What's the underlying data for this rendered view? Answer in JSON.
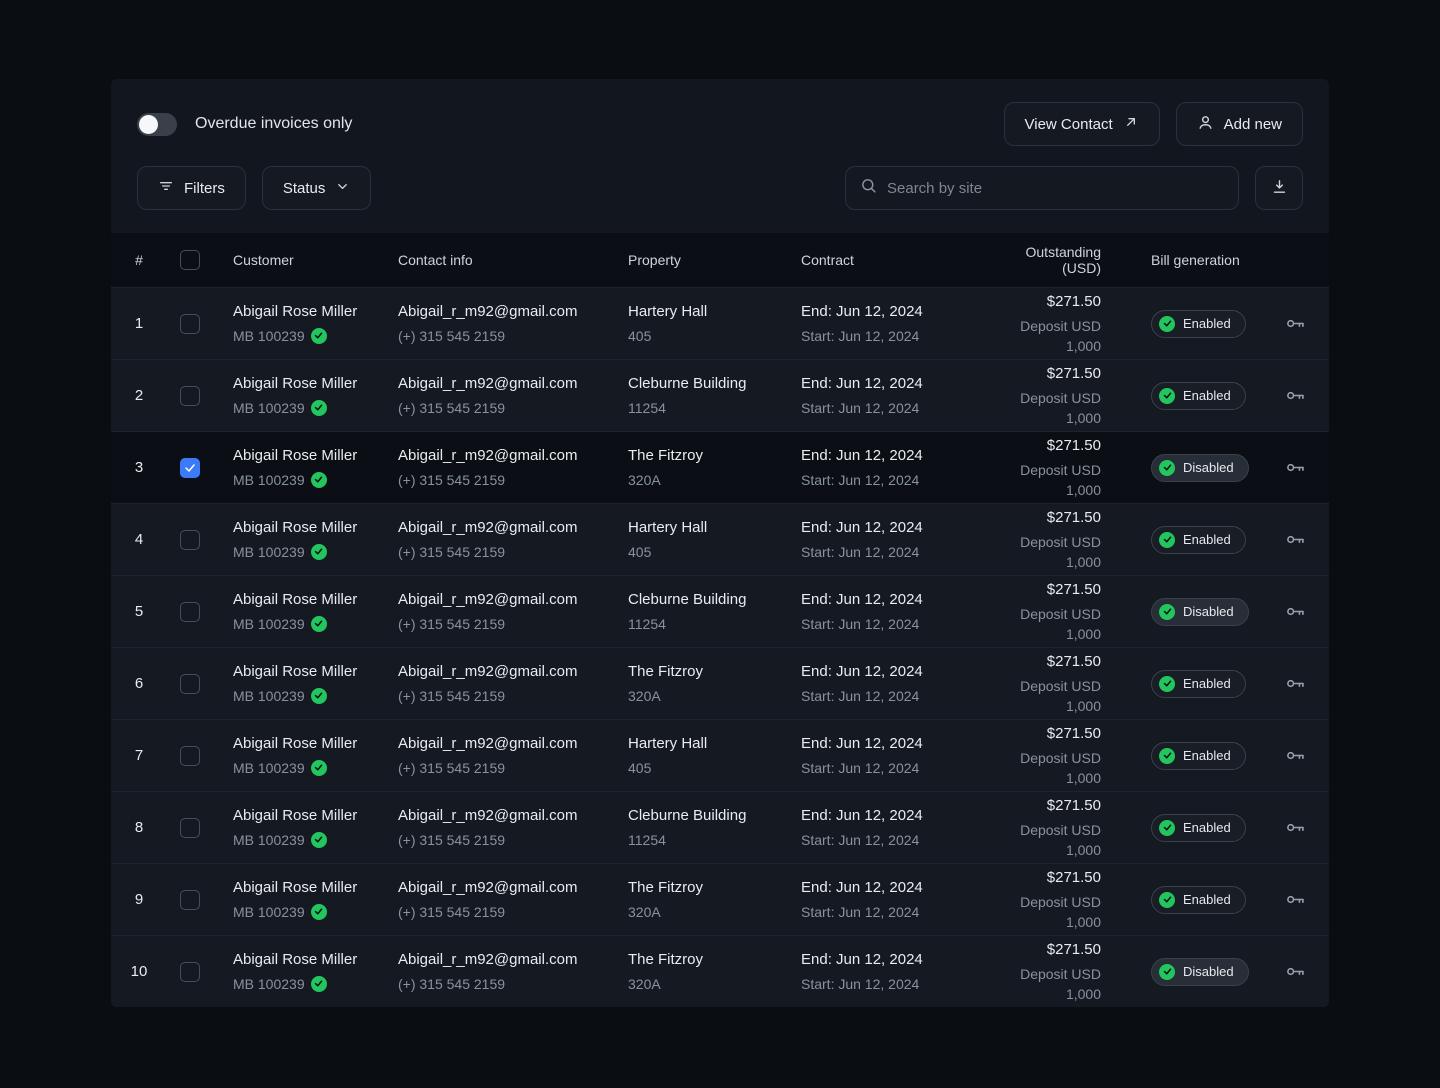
{
  "toolbar": {
    "overdue_toggle_label": "Overdue invoices only",
    "view_contact_label": "View Contact",
    "add_new_label": "Add new",
    "filters_label": "Filters",
    "status_label": "Status",
    "search_placeholder": "Search by site"
  },
  "colors": {
    "accent_green": "#22c55e",
    "checkbox_blue": "#3b7bf7",
    "panel_bg": "#12161e",
    "header_bg": "#0b0f15",
    "row_bg": "#151a22",
    "selected_row_bg": "#0b0e14"
  },
  "table": {
    "columns": {
      "num": "#",
      "customer": "Customer",
      "contact": "Contact info",
      "property": "Property",
      "contract": "Contract",
      "outstanding": "Outstanding (USD)",
      "bill": "Bill generation"
    },
    "rows": [
      {
        "num": "1",
        "checked": false,
        "selected": false,
        "customer_name": "Abigail Rose Miller",
        "customer_id": "MB 100239",
        "email": "Abigail_r_m92@gmail.com",
        "phone": "(+) 315 545 2159",
        "property_name": "Hartery Hall",
        "property_unit": "405",
        "contract_end": "End: Jun 12, 2024",
        "contract_start": "Start: Jun 12, 2024",
        "outstanding": "$271.50",
        "deposit": "Deposit USD 1,000",
        "bill_status": "Enabled"
      },
      {
        "num": "2",
        "checked": false,
        "selected": false,
        "customer_name": "Abigail Rose Miller",
        "customer_id": "MB 100239",
        "email": "Abigail_r_m92@gmail.com",
        "phone": "(+) 315 545 2159",
        "property_name": "Cleburne Building",
        "property_unit": "11254",
        "contract_end": "End: Jun 12, 2024",
        "contract_start": "Start: Jun 12, 2024",
        "outstanding": "$271.50",
        "deposit": "Deposit USD 1,000",
        "bill_status": "Enabled"
      },
      {
        "num": "3",
        "checked": true,
        "selected": true,
        "customer_name": "Abigail Rose Miller",
        "customer_id": "MB 100239",
        "email": "Abigail_r_m92@gmail.com",
        "phone": "(+) 315 545 2159",
        "property_name": "The Fitzroy",
        "property_unit": "320A",
        "contract_end": "End: Jun 12, 2024",
        "contract_start": "Start: Jun 12, 2024",
        "outstanding": "$271.50",
        "deposit": "Deposit USD 1,000",
        "bill_status": "Disabled"
      },
      {
        "num": "4",
        "checked": false,
        "selected": false,
        "customer_name": "Abigail Rose Miller",
        "customer_id": "MB 100239",
        "email": "Abigail_r_m92@gmail.com",
        "phone": "(+) 315 545 2159",
        "property_name": "Hartery Hall",
        "property_unit": "405",
        "contract_end": "End: Jun 12, 2024",
        "contract_start": "Start: Jun 12, 2024",
        "outstanding": "$271.50",
        "deposit": "Deposit USD 1,000",
        "bill_status": "Enabled"
      },
      {
        "num": "5",
        "checked": false,
        "selected": false,
        "customer_name": "Abigail Rose Miller",
        "customer_id": "MB 100239",
        "email": "Abigail_r_m92@gmail.com",
        "phone": "(+) 315 545 2159",
        "property_name": "Cleburne Building",
        "property_unit": "11254",
        "contract_end": "End: Jun 12, 2024",
        "contract_start": "Start: Jun 12, 2024",
        "outstanding": "$271.50",
        "deposit": "Deposit USD 1,000",
        "bill_status": "Disabled"
      },
      {
        "num": "6",
        "checked": false,
        "selected": false,
        "customer_name": "Abigail Rose Miller",
        "customer_id": "MB 100239",
        "email": "Abigail_r_m92@gmail.com",
        "phone": "(+) 315 545 2159",
        "property_name": "The Fitzroy",
        "property_unit": "320A",
        "contract_end": "End: Jun 12, 2024",
        "contract_start": "Start: Jun 12, 2024",
        "outstanding": "$271.50",
        "deposit": "Deposit USD 1,000",
        "bill_status": "Enabled"
      },
      {
        "num": "7",
        "checked": false,
        "selected": false,
        "customer_name": "Abigail Rose Miller",
        "customer_id": "MB 100239",
        "email": "Abigail_r_m92@gmail.com",
        "phone": "(+) 315 545 2159",
        "property_name": "Hartery Hall",
        "property_unit": "405",
        "contract_end": "End: Jun 12, 2024",
        "contract_start": "Start: Jun 12, 2024",
        "outstanding": "$271.50",
        "deposit": "Deposit USD 1,000",
        "bill_status": "Enabled"
      },
      {
        "num": "8",
        "checked": false,
        "selected": false,
        "customer_name": "Abigail Rose Miller",
        "customer_id": "MB 100239",
        "email": "Abigail_r_m92@gmail.com",
        "phone": "(+) 315 545 2159",
        "property_name": "Cleburne Building",
        "property_unit": "11254",
        "contract_end": "End: Jun 12, 2024",
        "contract_start": "Start: Jun 12, 2024",
        "outstanding": "$271.50",
        "deposit": "Deposit USD 1,000",
        "bill_status": "Enabled"
      },
      {
        "num": "9",
        "checked": false,
        "selected": false,
        "customer_name": "Abigail Rose Miller",
        "customer_id": "MB 100239",
        "email": "Abigail_r_m92@gmail.com",
        "phone": "(+) 315 545 2159",
        "property_name": "The Fitzroy",
        "property_unit": "320A",
        "contract_end": "End: Jun 12, 2024",
        "contract_start": "Start: Jun 12, 2024",
        "outstanding": "$271.50",
        "deposit": "Deposit USD 1,000",
        "bill_status": "Enabled"
      },
      {
        "num": "10",
        "checked": false,
        "selected": false,
        "customer_name": "Abigail Rose Miller",
        "customer_id": "MB 100239",
        "email": "Abigail_r_m92@gmail.com",
        "phone": "(+) 315 545 2159",
        "property_name": "The Fitzroy",
        "property_unit": "320A",
        "contract_end": "End: Jun 12, 2024",
        "contract_start": "Start: Jun 12, 2024",
        "outstanding": "$271.50",
        "deposit": "Deposit USD 1,000",
        "bill_status": "Disabled"
      }
    ]
  }
}
